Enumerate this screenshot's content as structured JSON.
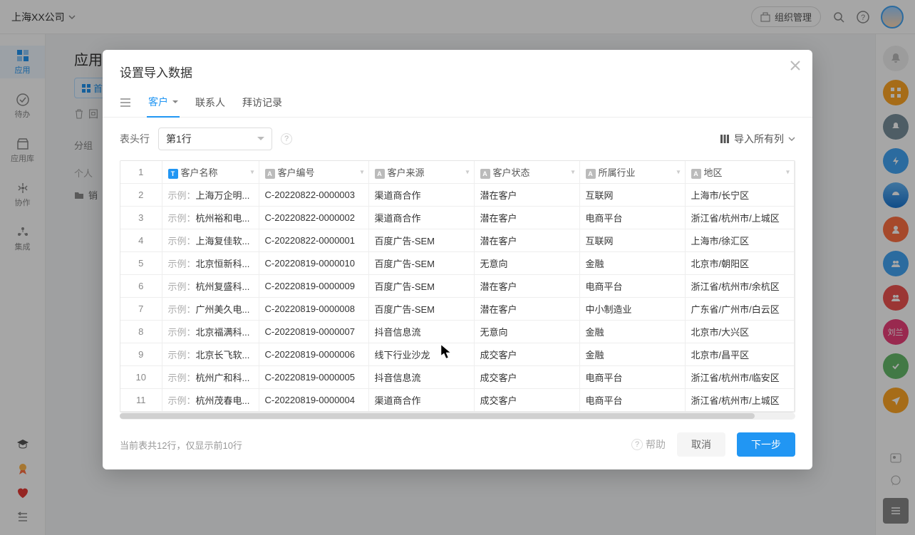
{
  "header": {
    "company": "上海XX公司",
    "org_btn": "组织管理"
  },
  "left_nav": {
    "items": [
      {
        "label": "应用"
      },
      {
        "label": "待办"
      },
      {
        "label": "应用库"
      },
      {
        "label": "协作"
      },
      {
        "label": "集成"
      }
    ]
  },
  "page": {
    "title": "应用",
    "toolbar_home": "首",
    "toolbar_recycle": "回",
    "group_label": "分组",
    "personal_label": "个人",
    "sales_label": "销"
  },
  "modal": {
    "title": "设置导入数据",
    "tabs": {
      "customer": "客户",
      "contact": "联系人",
      "visit": "拜访记录"
    },
    "header_row_label": "表头行",
    "header_row_value": "第1行",
    "import_all_cols": "导入所有列",
    "columns": {
      "c1": "客户名称",
      "c2": "客户编号",
      "c3": "客户来源",
      "c4": "客户状态",
      "c5": "所属行业",
      "c6": "地区"
    },
    "sample_prefix": "示例：",
    "rows": [
      {
        "n": "2",
        "name": "上海万企明...",
        "code": "C-20220822-0000003",
        "src": "渠道商合作",
        "status": "潜在客户",
        "industry": "互联网",
        "region": "上海市/长宁区"
      },
      {
        "n": "3",
        "name": "杭州裕和电...",
        "code": "C-20220822-0000002",
        "src": "渠道商合作",
        "status": "潜在客户",
        "industry": "电商平台",
        "region": "浙江省/杭州市/上城区"
      },
      {
        "n": "4",
        "name": "上海复佳软...",
        "code": "C-20220822-0000001",
        "src": "百度广告-SEM",
        "status": "潜在客户",
        "industry": "互联网",
        "region": "上海市/徐汇区"
      },
      {
        "n": "5",
        "name": "北京恒新科...",
        "code": "C-20220819-0000010",
        "src": "百度广告-SEM",
        "status": "无意向",
        "industry": "金融",
        "region": "北京市/朝阳区"
      },
      {
        "n": "6",
        "name": "杭州复盛科...",
        "code": "C-20220819-0000009",
        "src": "百度广告-SEM",
        "status": "潜在客户",
        "industry": "电商平台",
        "region": "浙江省/杭州市/余杭区"
      },
      {
        "n": "7",
        "name": "广州美久电...",
        "code": "C-20220819-0000008",
        "src": "百度广告-SEM",
        "status": "潜在客户",
        "industry": "中小制造业",
        "region": "广东省/广州市/白云区"
      },
      {
        "n": "8",
        "name": "北京福满科...",
        "code": "C-20220819-0000007",
        "src": "抖音信息流",
        "status": "无意向",
        "industry": "金融",
        "region": "北京市/大兴区"
      },
      {
        "n": "9",
        "name": "北京长飞软...",
        "code": "C-20220819-0000006",
        "src": "线下行业沙龙",
        "status": "成交客户",
        "industry": "金融",
        "region": "北京市/昌平区"
      },
      {
        "n": "10",
        "name": "杭州广和科...",
        "code": "C-20220819-0000005",
        "src": "抖音信息流",
        "status": "成交客户",
        "industry": "电商平台",
        "region": "浙江省/杭州市/临安区"
      },
      {
        "n": "11",
        "name": "杭州茂春电...",
        "code": "C-20220819-0000004",
        "src": "渠道商合作",
        "status": "成交客户",
        "industry": "电商平台",
        "region": "浙江省/杭州市/上城区"
      }
    ],
    "footer_note": "当前表共12行，仅显示前10行",
    "help": "帮助",
    "cancel": "取消",
    "next": "下一步",
    "header_rownum": "1"
  },
  "right_badge": "刘兰"
}
